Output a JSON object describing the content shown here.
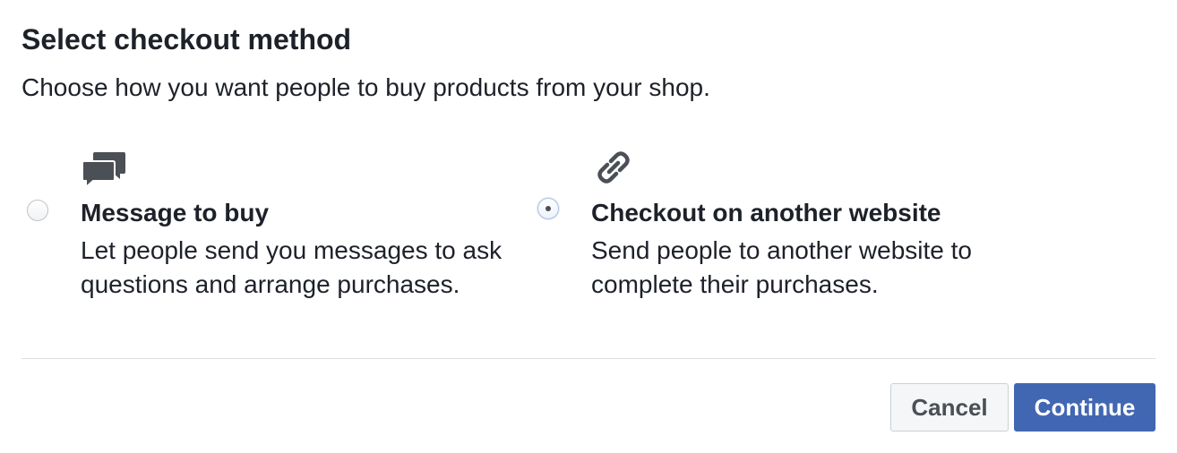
{
  "dialog": {
    "title": "Select checkout method",
    "subtitle": "Choose how you want people to buy products from your shop."
  },
  "options": [
    {
      "icon": "message-bubbles-icon",
      "title": "Message to buy",
      "description": "Let people send you messages to ask questions and arrange purchases.",
      "selected": false
    },
    {
      "icon": "link-icon",
      "title": "Checkout on another website",
      "description": "Send people to another website to complete their purchases.",
      "selected": true
    }
  ],
  "footer": {
    "cancel_label": "Cancel",
    "continue_label": "Continue"
  },
  "colors": {
    "primary": "#4267b2",
    "text": "#1d2129",
    "icon": "#4b4f56",
    "divider": "#dddfe2"
  }
}
